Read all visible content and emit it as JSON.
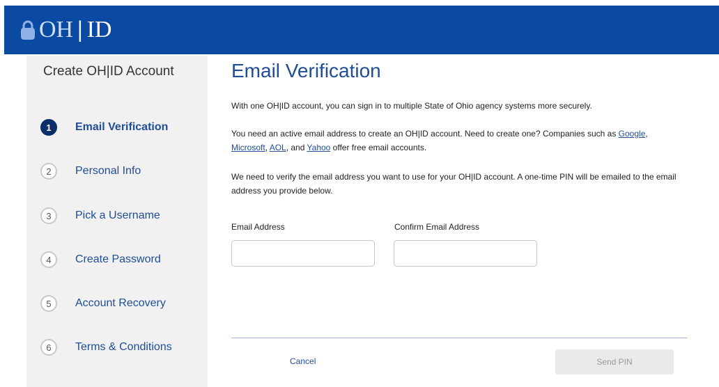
{
  "header": {
    "logo_oh": "OH",
    "logo_sep": "|",
    "logo_id": "ID"
  },
  "sidebar": {
    "title": "Create OH|ID Account",
    "steps": [
      {
        "num": "1",
        "label": "Email Verification",
        "active": true
      },
      {
        "num": "2",
        "label": "Personal Info",
        "active": false
      },
      {
        "num": "3",
        "label": "Pick a Username",
        "active": false
      },
      {
        "num": "4",
        "label": "Create Password",
        "active": false
      },
      {
        "num": "5",
        "label": "Account Recovery",
        "active": false
      },
      {
        "num": "6",
        "label": "Terms & Conditions",
        "active": false
      }
    ]
  },
  "main": {
    "title": "Email Verification",
    "para1": "With one OH|ID account, you can sign in to multiple State of Ohio agency systems more securely.",
    "para2_start": "You need an active email address to create an OH|ID account. Need to create one? Companies such as ",
    "links": {
      "google": "Google",
      "microsoft": "Microsoft",
      "aol": "AOL",
      "yahoo": "Yahoo"
    },
    "para2_comma1": ", ",
    "para2_comma2": ", ",
    "para2_and": ", and ",
    "para2_end": " offer free email accounts.",
    "para3": "We need to verify the email address you want to use for your OH|ID account. A one-time PIN will be emailed to the email address you provide below.",
    "email_label": "Email Address",
    "email_value": "",
    "confirm_label": "Confirm Email Address",
    "confirm_value": "",
    "cancel_label": "Cancel",
    "send_label": "Send PIN"
  },
  "colors": {
    "header_bg": "#0b4aa3",
    "accent": "#1f4d96",
    "active_step": "#0b2d6b",
    "sidebar_bg": "#f1f1f1"
  }
}
